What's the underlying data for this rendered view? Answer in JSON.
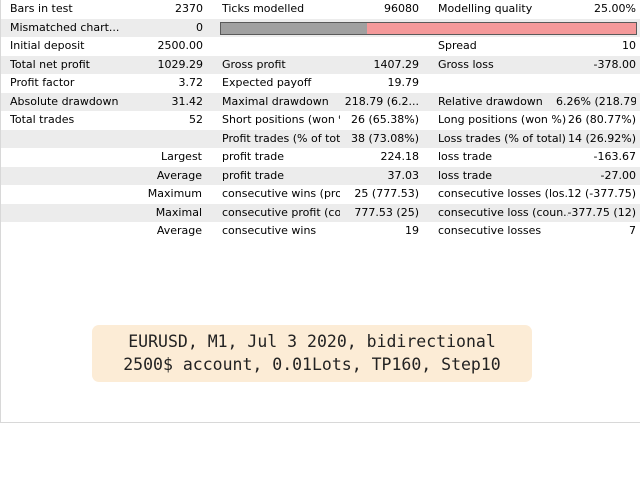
{
  "rows": [
    {
      "c1": "Bars in test",
      "v1": "2370",
      "c2": "Ticks modelled",
      "v2": "96080",
      "c3": "Modelling quality",
      "v3": "25.00%"
    },
    {
      "c1": "Mismatched chart...",
      "v1": "0",
      "c2": "",
      "v2": "",
      "c3": "",
      "v3": ""
    },
    {
      "c1": "Initial deposit",
      "v1": "2500.00",
      "c2": "",
      "v2": "",
      "c3": "Spread",
      "v3": "10"
    },
    {
      "c1": "Total net profit",
      "v1": "1029.29",
      "c2": "Gross profit",
      "v2": "1407.29",
      "c3": "Gross loss",
      "v3": "-378.00"
    },
    {
      "c1": "Profit factor",
      "v1": "3.72",
      "c2": "Expected payoff",
      "v2": "19.79",
      "c3": "",
      "v3": ""
    },
    {
      "c1": "Absolute drawdown",
      "v1": "31.42",
      "c2": "Maximal drawdown",
      "v2": "218.79 (6.2...",
      "c3": "Relative drawdown",
      "v3": "6.26% (218.79)"
    },
    {
      "c1": "Total trades",
      "v1": "52",
      "c2": "Short positions (won %)",
      "v2": "26 (65.38%)",
      "c3": "Long positions (won %)",
      "v3": "26 (80.77%)"
    },
    {
      "c1": "",
      "v1": "",
      "c2": "Profit trades (% of total)",
      "v2": "38 (73.08%)",
      "c3": "Loss trades (% of total)",
      "v3": "14 (26.92%)"
    },
    {
      "c1": "",
      "v1": "Largest",
      "c2": "profit trade",
      "v2": "224.18",
      "c3": "loss trade",
      "v3": "-163.67"
    },
    {
      "c1": "",
      "v1": "Average",
      "c2": "profit trade",
      "v2": "37.03",
      "c3": "loss trade",
      "v3": "-27.00"
    },
    {
      "c1": "",
      "v1": "Maximum",
      "c2": "consecutive wins (prof...",
      "v2": "25 (777.53)",
      "c3": "consecutive losses (los...",
      "v3": "12 (-377.75)"
    },
    {
      "c1": "",
      "v1": "Maximal",
      "c2": "consecutive profit (co...",
      "v2": "777.53 (25)",
      "c3": "consecutive loss (coun...",
      "v3": "-377.75 (12)"
    },
    {
      "c1": "",
      "v1": "Average",
      "c2": "consecutive wins",
      "v2": "19",
      "c3": "consecutive losses",
      "v3": "7"
    }
  ],
  "modelling_quality_fraction": 0.25,
  "colors": {
    "bar_filled": "#a0a0a0",
    "bar_empty": "#f4999a",
    "row_alt": "#ececec",
    "caption_bg": "#fcecd6"
  },
  "caption": {
    "line1": "EURUSD, M1, Jul 3 2020, bidirectional",
    "line2": "2500$ account, 0.01Lots, TP160, Step10"
  }
}
